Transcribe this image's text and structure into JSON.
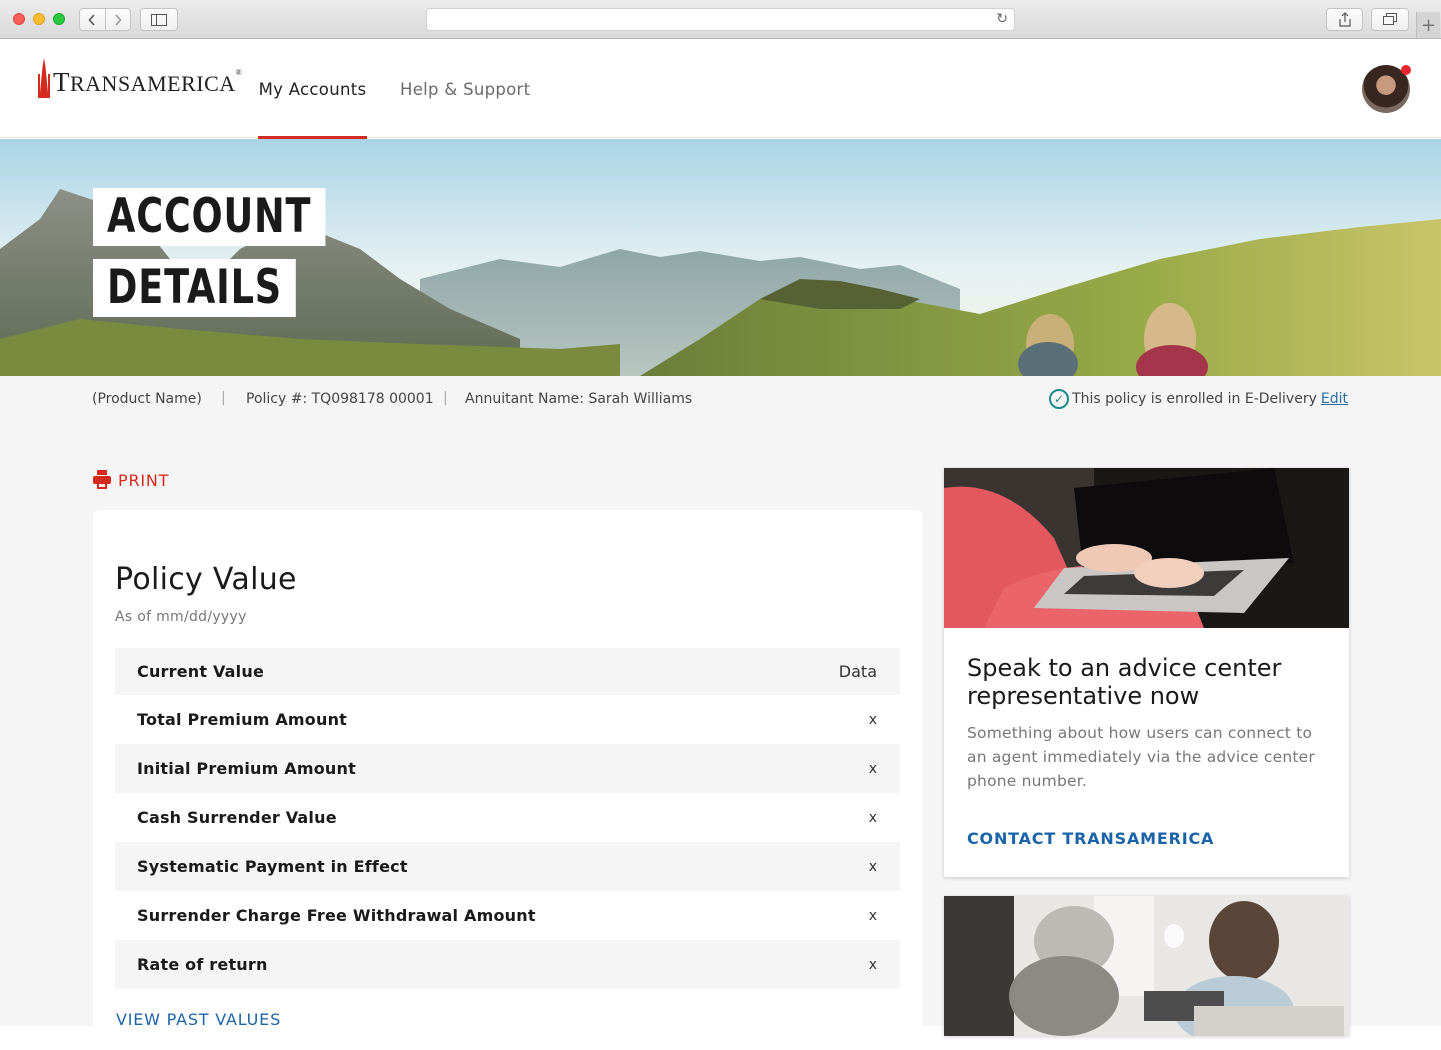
{
  "browser": {
    "url": "",
    "new_tab_label": "+"
  },
  "header": {
    "logo_text_first": "T",
    "logo_text_rest": "RANSAMERICA",
    "logo_reg": "®",
    "nav": [
      {
        "label": "My Accounts",
        "active": true
      },
      {
        "label": "Help & Support",
        "active": false
      }
    ],
    "notification_color": "#e8242f"
  },
  "hero": {
    "title_line1": "ACCOUNT",
    "title_line2": "DETAILS"
  },
  "policy_info": {
    "product_name": "(Product Name)",
    "policy_number": "Policy #: TQ098178 00001",
    "annuitant": "Annuitant Name: Sarah Williams",
    "edelivery_text": "This policy is enrolled in E-Delivery",
    "edit_label": "Edit"
  },
  "print_label": "PRINT",
  "policy_value": {
    "title": "Policy Value",
    "as_of": "As of mm/dd/yyyy",
    "header": {
      "label": "Current Value",
      "value": "Data"
    },
    "rows": [
      {
        "label": "Total Premium Amount",
        "value": "x"
      },
      {
        "label": "Initial Premium Amount",
        "value": "x"
      },
      {
        "label": "Cash Surrender Value",
        "value": "x"
      },
      {
        "label": "Systematic Payment in Effect",
        "value": "x"
      },
      {
        "label": "Surrender Charge Free Withdrawal Amount",
        "value": "x"
      },
      {
        "label": "Rate of return",
        "value": "x"
      }
    ],
    "view_past_label": "VIEW PAST VALUES"
  },
  "advice_card": {
    "title": "Speak to an advice center representative now",
    "body": "Something about how users can connect to an agent immediately via the advice center phone number.",
    "link": "CONTACT TRANSAMERICA"
  },
  "colors": {
    "brand_red": "#d52b1e",
    "link_blue": "#1c64a8",
    "check_teal": "#1e8a8c"
  }
}
